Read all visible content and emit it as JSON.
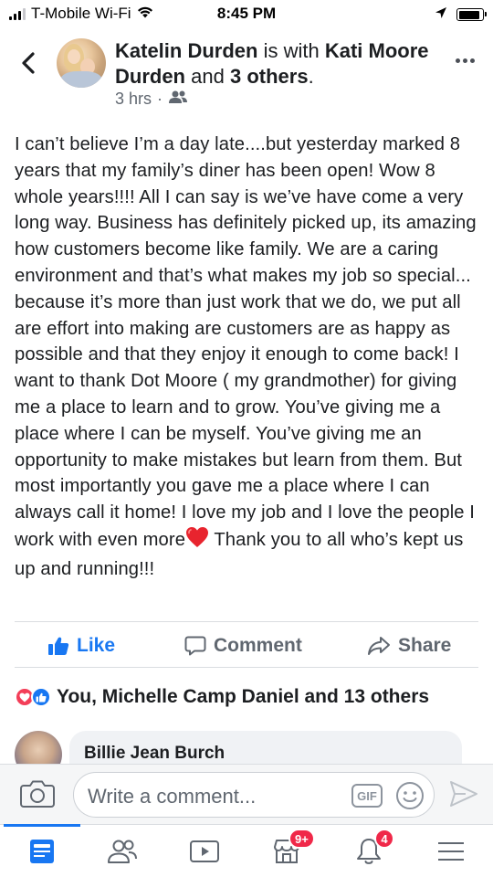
{
  "status_bar": {
    "carrier": "T-Mobile Wi-Fi",
    "time": "8:45 PM",
    "battery_level": 0.9
  },
  "post": {
    "author": "Katelin Durden",
    "with_text": "is with",
    "tagged_name": "Kati Moore Durden",
    "and_text": "and",
    "others_text": "3 others",
    "period": ".",
    "time_ago": "3 hrs",
    "separator": "·",
    "privacy_icon": "friends-icon",
    "body_part1": "I can’t believe I’m a day late....but yesterday marked 8 years that my family’s diner has been open! Wow 8 whole years!!!! All I can say is we’ve have come a very long way. Business has definitely picked up, its amazing how customers become like family. We are a caring environment and that’s what makes my job so special... because it’s more than just work that we do, we put all are effort into making are customers are as happy as possible and that they enjoy it enough to come back! I want to thank Dot Moore ( my grandmother) for giving me a place to learn and to grow. You’ve giving me a place where I can be myself. You’ve giving me an opportunity to make mistakes but learn from them. But most importantly you gave me a place where I can always call it home! I love my job and I love the people I work with even more",
    "body_emoji": "heart",
    "body_part2": " Thank you to all who’s kept us up and running!!!"
  },
  "actions": {
    "like": "Like",
    "comment": "Comment",
    "share": "Share"
  },
  "reactions": {
    "text": "You, Michelle Camp Daniel and 13 others",
    "icons": [
      "love",
      "like"
    ]
  },
  "comment_preview": {
    "name": "Billie Jean Burch"
  },
  "write_comment": {
    "placeholder": "Write a comment...",
    "gif_label": "GIF"
  },
  "tab_bar": {
    "tabs": [
      {
        "name": "news-feed",
        "icon": "news-feed-icon",
        "badge": ""
      },
      {
        "name": "friends",
        "icon": "friends-icon",
        "badge": ""
      },
      {
        "name": "watch",
        "icon": "video-icon",
        "badge": ""
      },
      {
        "name": "marketplace",
        "icon": "marketplace-icon",
        "badge": "9+"
      },
      {
        "name": "notifications",
        "icon": "bell-icon",
        "badge": "4"
      },
      {
        "name": "menu",
        "icon": "menu-icon",
        "badge": ""
      }
    ]
  },
  "colors": {
    "accent": "#1877f2",
    "badge": "#f02849",
    "love": "#f33e58",
    "secondary_text": "#606770"
  }
}
